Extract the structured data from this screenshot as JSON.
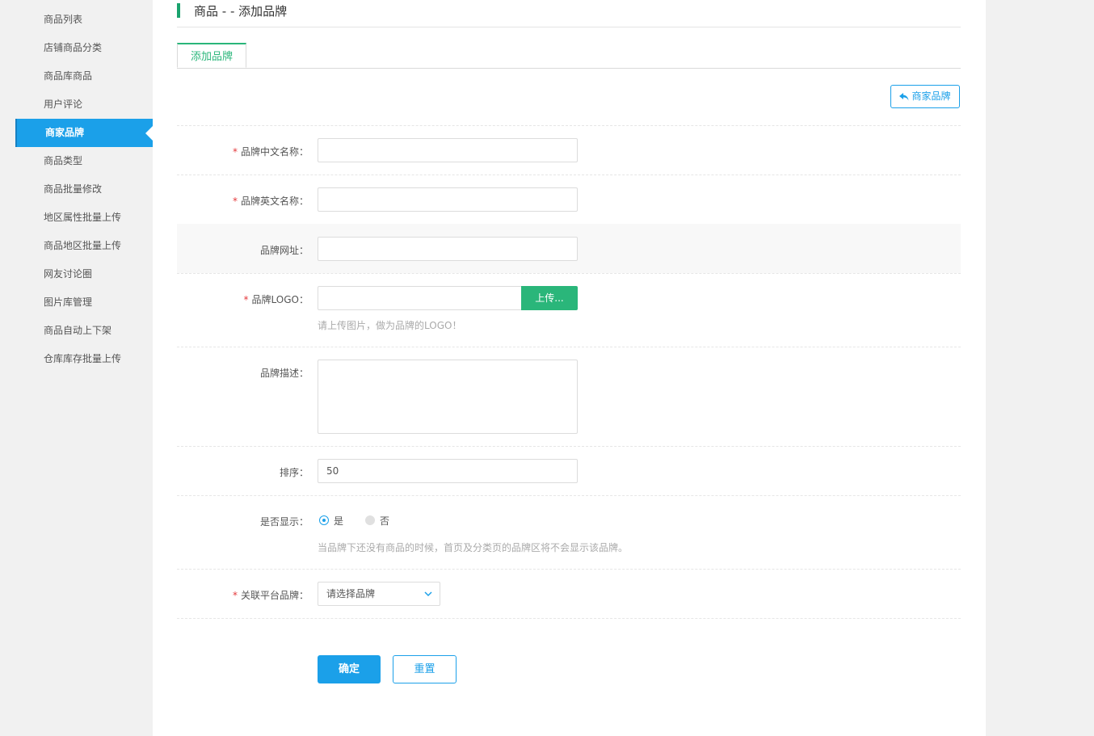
{
  "sidebar": {
    "items": [
      {
        "label": "商品列表"
      },
      {
        "label": "店铺商品分类"
      },
      {
        "label": "商品库商品"
      },
      {
        "label": "用户评论"
      },
      {
        "label": "商家品牌",
        "active": true
      },
      {
        "label": "商品类型"
      },
      {
        "label": "商品批量修改"
      },
      {
        "label": "地区属性批量上传"
      },
      {
        "label": "商品地区批量上传"
      },
      {
        "label": "网友讨论圈"
      },
      {
        "label": "图片库管理"
      },
      {
        "label": "商品自动上下架"
      },
      {
        "label": "仓库库存批量上传"
      }
    ]
  },
  "header": {
    "title": "商品 - - 添加品牌"
  },
  "tabs": [
    {
      "label": "添加品牌"
    }
  ],
  "toolbar": {
    "back_label": "商家品牌",
    "back_icon": "reply-arrow-icon"
  },
  "form": {
    "required_mark": "*",
    "cn_name": {
      "label": "品牌中文名称：",
      "value": ""
    },
    "en_name": {
      "label": "品牌英文名称：",
      "value": ""
    },
    "website": {
      "label": "品牌网址：",
      "value": ""
    },
    "logo": {
      "label": "品牌LOGO：",
      "value": "",
      "upload_label": "上传...",
      "hint": "请上传图片，做为品牌的LOGO！"
    },
    "description": {
      "label": "品牌描述：",
      "value": ""
    },
    "sort": {
      "label": "排序：",
      "value": "50"
    },
    "show": {
      "label": "是否显示：",
      "yes_label": "是",
      "no_label": "否",
      "selected": "是",
      "hint": "当品牌下还没有商品的时候，首页及分类页的品牌区将不会显示该品牌。"
    },
    "platform_brand": {
      "label": "关联平台品牌：",
      "selected": "请选择品牌"
    },
    "submit_label": "确定",
    "reset_label": "重置"
  },
  "colors": {
    "primary": "#1ba0e9",
    "green": "#2ab67a",
    "required": "#e4393c"
  }
}
